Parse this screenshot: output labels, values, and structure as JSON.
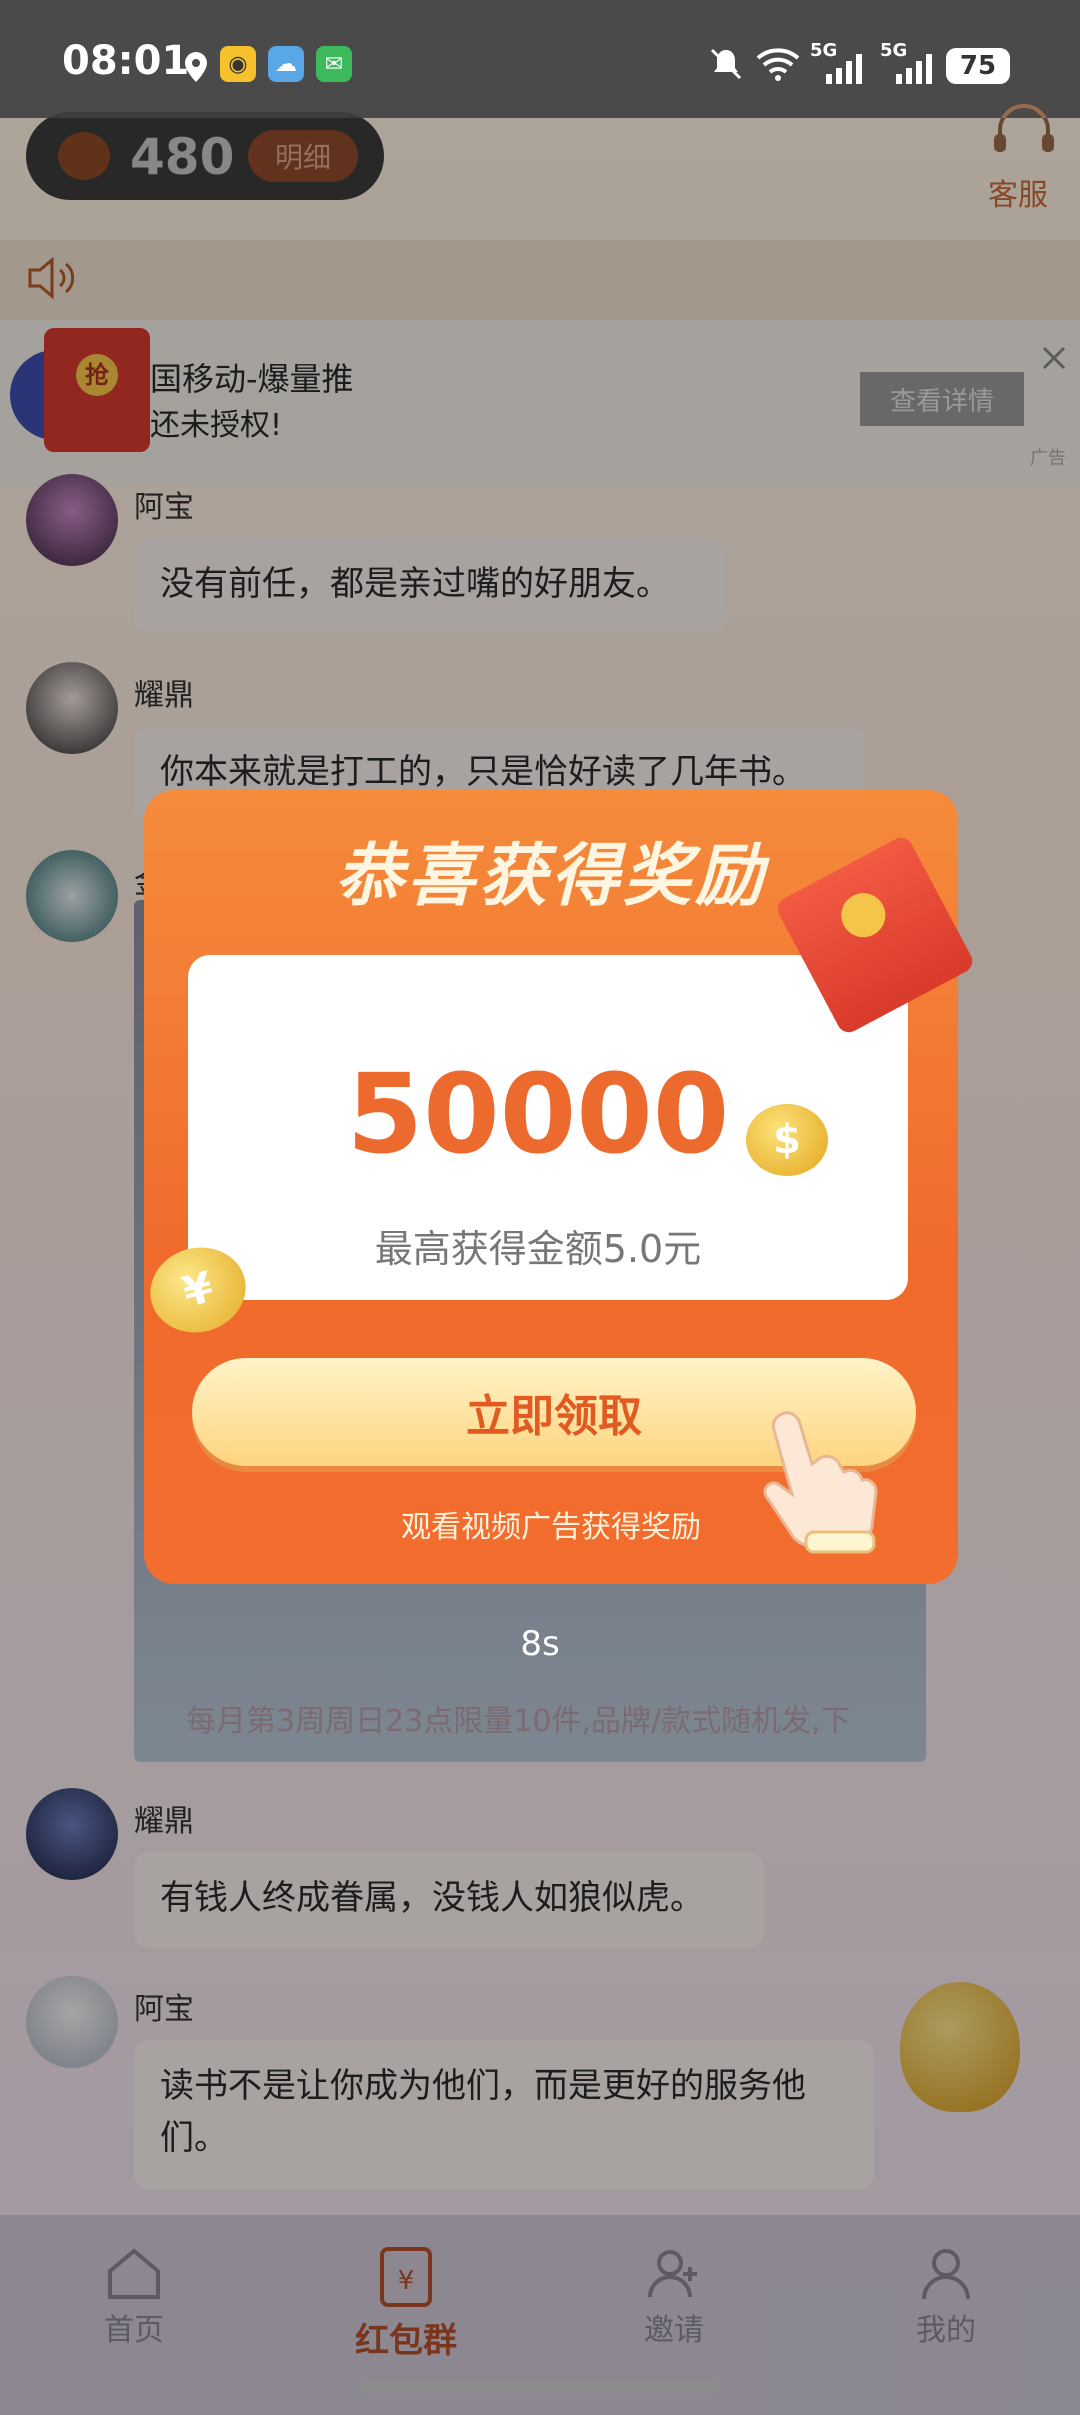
{
  "status_bar": {
    "time": "08:01",
    "battery": "75",
    "network_1": "5G",
    "network_2": "5G"
  },
  "header": {
    "coin_count": "480",
    "detail_label": "明细",
    "service_label": "客服"
  },
  "ad": {
    "title": "国移动-爆量推",
    "subtitle": "还未授权!",
    "action_label": "查看详情",
    "tag": "广告",
    "red_packet_char": "抢"
  },
  "chat": [
    {
      "name": "阿宝",
      "message": "没有前任，都是亲过嘴的好朋友。"
    },
    {
      "name": "耀鼎",
      "message": "你本来就是打工的，只是恰好读了几年书。"
    },
    {
      "name": "耀鼎",
      "message": "有钱人终成眷属，没钱人如狼似虎。"
    },
    {
      "name": "阿宝",
      "message": "读书不是让你成为他们，而是更好的服务他们。"
    }
  ],
  "partial_name": "金",
  "modal": {
    "title": "恭喜获得奖励",
    "amount": "50000",
    "description": "最高获得金额5.0元",
    "claim_label": "立即领取",
    "hint": "观看视频广告获得奖励",
    "coin_symbol": "$",
    "coin_symbol_2": "¥"
  },
  "video": {
    "countdown": "8s",
    "banner_text": "每月第3周周日23点限量10件,品牌/款式随机发,下"
  },
  "nav": [
    {
      "label": "首页"
    },
    {
      "label": "红包群"
    },
    {
      "label": "邀请"
    },
    {
      "label": "我的"
    }
  ],
  "colors": {
    "accent": "#f06a2c",
    "active_nav": "#b4502a"
  }
}
